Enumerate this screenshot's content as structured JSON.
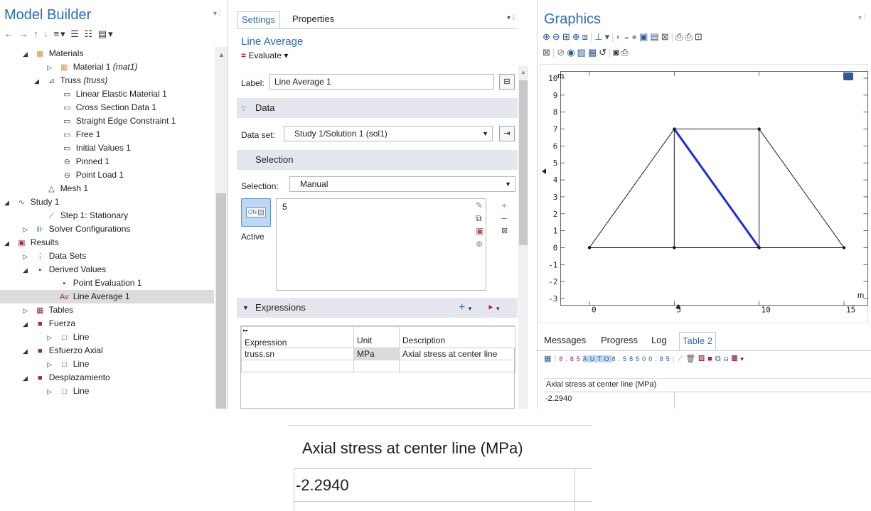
{
  "model_builder": {
    "title": "Model Builder",
    "items": [
      {
        "label": "Materials",
        "italic": ""
      },
      {
        "label": "Material 1 ",
        "italic": "(mat1)"
      },
      {
        "label": "Truss ",
        "italic": "(truss)"
      },
      {
        "label": "Linear Elastic Material 1",
        "italic": ""
      },
      {
        "label": "Cross Section Data 1",
        "italic": ""
      },
      {
        "label": "Straight Edge Constraint 1",
        "italic": ""
      },
      {
        "label": "Free 1",
        "italic": ""
      },
      {
        "label": "Initial Values 1",
        "italic": ""
      },
      {
        "label": "Pinned 1",
        "italic": ""
      },
      {
        "label": "Point Load 1",
        "italic": ""
      },
      {
        "label": "Mesh 1",
        "italic": ""
      },
      {
        "label": "Study 1",
        "italic": ""
      },
      {
        "label": "Step 1: Stationary",
        "italic": ""
      },
      {
        "label": "Solver Configurations",
        "italic": ""
      },
      {
        "label": "Results",
        "italic": ""
      },
      {
        "label": "Data Sets",
        "italic": ""
      },
      {
        "label": "Derived Values",
        "italic": ""
      },
      {
        "label": "Point Evaluation 1",
        "italic": ""
      },
      {
        "label": "Line Average 1",
        "italic": ""
      },
      {
        "label": "Tables",
        "italic": ""
      },
      {
        "label": "Fuerza",
        "italic": ""
      },
      {
        "label": "Line",
        "italic": ""
      },
      {
        "label": "Esfuerzo Axial",
        "italic": ""
      },
      {
        "label": "Line",
        "italic": ""
      },
      {
        "label": "Desplazamiento",
        "italic": ""
      },
      {
        "label": "Line",
        "italic": ""
      }
    ]
  },
  "settings": {
    "tabs": [
      "Settings",
      "Properties"
    ],
    "node_title": "Line Average",
    "evaluate_label": "Evaluate",
    "label_caption": "Label:",
    "label_value": "Line Average 1",
    "data_section": "Data",
    "dataset_caption": "Data set:",
    "dataset_value": "Study 1/Solution 1 (sol1)",
    "selection_section": "Selection",
    "selection_caption": "Selection:",
    "selection_value": "Manual",
    "selection_list": "5",
    "active_toggle": "ON",
    "active_label": "Active",
    "expressions_section": "Expressions",
    "expr_headers": [
      "Expression",
      "Unit",
      "Description"
    ],
    "expr_rows": [
      {
        "expression": "truss.sn",
        "unit": "MPa",
        "description": "Axial stress at center line"
      }
    ]
  },
  "graphics": {
    "title": "Graphics",
    "y_unit": "m",
    "x_unit": "m"
  },
  "chart_data": {
    "type": "line",
    "title": "",
    "xlim": [
      0,
      15
    ],
    "ylim": [
      -3,
      10
    ],
    "x_ticks": [
      "0",
      "5",
      "10",
      "15"
    ],
    "y_ticks": [
      "10",
      "9",
      "8",
      "7",
      "6",
      "5",
      "4",
      "3",
      "2",
      "1",
      "0",
      "-1",
      "-2",
      "-3"
    ],
    "nodes": [
      [
        0,
        0
      ],
      [
        5,
        0
      ],
      [
        10,
        0
      ],
      [
        15,
        0
      ],
      [
        5,
        7
      ],
      [
        10,
        7
      ]
    ],
    "members": [
      [
        [
          0,
          0
        ],
        [
          5,
          7
        ]
      ],
      [
        [
          5,
          7
        ],
        [
          10,
          7
        ]
      ],
      [
        [
          10,
          7
        ],
        [
          15,
          0
        ]
      ],
      [
        [
          0,
          0
        ],
        [
          15,
          0
        ]
      ],
      [
        [
          5,
          0
        ],
        [
          5,
          7
        ]
      ],
      [
        [
          10,
          0
        ],
        [
          10,
          7
        ]
      ]
    ],
    "highlighted_member": [
      [
        5,
        7
      ],
      [
        10,
        0
      ]
    ],
    "highlight_color": "#1a2be0"
  },
  "messages": {
    "tabs": [
      "Messages",
      "Progress",
      "Log",
      "Table 2"
    ],
    "table_header": "Axial stress at center line (MPa)",
    "table_value": "-2.2940"
  },
  "zoom": {
    "table_header": "Axial stress at center line (MPa)",
    "table_value": "-2.2940"
  }
}
